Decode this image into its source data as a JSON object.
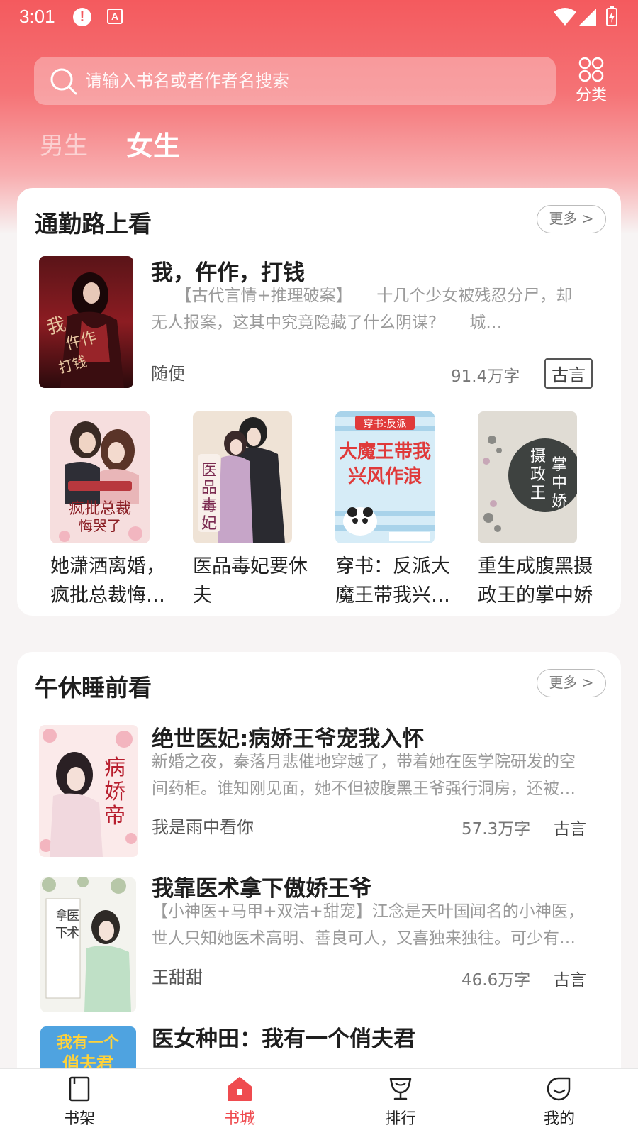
{
  "status_bar": {
    "time": "3:01",
    "alert_icon": "alert-icon",
    "a_icon": "a-icon"
  },
  "search": {
    "placeholder": "请输入书名或者作者名搜索",
    "value": ""
  },
  "category": {
    "label": "分类",
    "icon": "grid-icon"
  },
  "tabs": [
    {
      "label": "男生",
      "active": false
    },
    {
      "label": "女生",
      "active": true
    }
  ],
  "section_commute": {
    "title": "通勤路上看",
    "more": "更多 >",
    "featured": {
      "title": "我，仵作，打钱",
      "description": "　　【古代言情+推理破案】　　十几个少女被残忍分尸，却无人报案，这其中究竟隐藏了什么阴谋?　　城…",
      "author": "随便",
      "words": "91.4万字",
      "genre": "古言"
    },
    "grid": [
      {
        "title": "她潇洒离婚，疯批总裁悔…"
      },
      {
        "title": "医品毒妃要休夫"
      },
      {
        "title": "穿书：反派大魔王带我兴…"
      },
      {
        "title": "重生成腹黑摄政王的掌中娇"
      }
    ]
  },
  "section_nap": {
    "title": "午休睡前看",
    "more": "更多 >",
    "books": [
      {
        "title": "绝世医妃:病娇王爷宠我入怀",
        "description": "新婚之夜，秦落月悲催地穿越了，带着她在医学院研发的空间药柜。谁知刚见面，她不但被腹黑王爷强行洞房，还被…",
        "author": "我是雨中看你",
        "words": "57.3万字",
        "genre": "古言"
      },
      {
        "title": "我靠医术拿下傲娇王爷",
        "description": "【小神医+马甲+双洁+甜宠】江念是天叶国闻名的小神医，世人只知她医术高明、善良可人，又喜独来独往。可少有…",
        "author": "王甜甜",
        "words": "46.6万字",
        "genre": "古言"
      },
      {
        "title": "医女种田：我有一个俏夫君"
      }
    ]
  },
  "bottom_nav": [
    {
      "label": "书架",
      "icon": "bookshelf-icon"
    },
    {
      "label": "书城",
      "icon": "bookstore-icon",
      "active": true
    },
    {
      "label": "排行",
      "icon": "trophy-icon"
    },
    {
      "label": "我的",
      "icon": "profile-icon"
    }
  ],
  "colors": {
    "accent": "#ef4b4f",
    "header_top": "#f45a5e"
  }
}
